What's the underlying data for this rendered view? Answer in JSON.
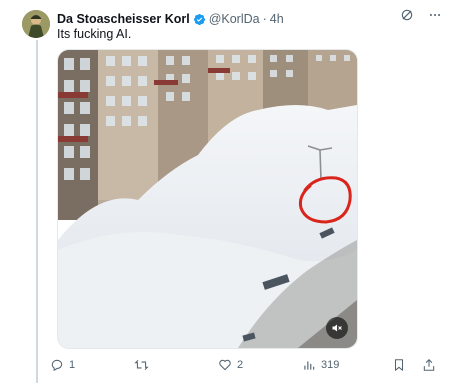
{
  "post": {
    "author_name": "Da Stoascheisser Korl",
    "handle": "@KorlDa",
    "separator": "·",
    "time": "4h",
    "text": "Its fucking AI."
  },
  "media": {
    "type": "video",
    "muted": true,
    "accent_circle_color": "#d9261c"
  },
  "actions": {
    "replies": "1",
    "reposts": "",
    "likes": "2",
    "views": "319"
  },
  "colors": {
    "verified": "#1d9bf0",
    "muted_text": "#536471"
  }
}
